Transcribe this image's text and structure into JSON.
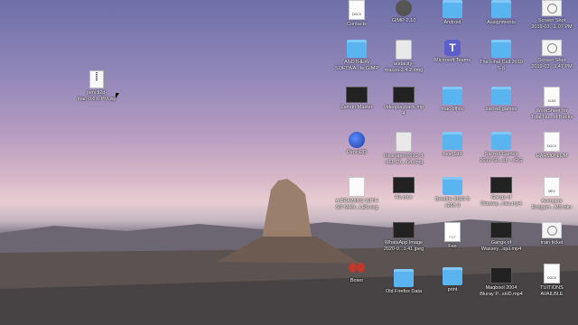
{
  "desktop": {
    "icons": [
      {
        "label": "Contacts",
        "type": "doc",
        "tag": "DOCX"
      },
      {
        "label": "GIMP-2.10",
        "type": "gimp"
      },
      {
        "label": "Android",
        "type": "folder"
      },
      {
        "label": "Assignments",
        "type": "folder"
      },
      {
        "label": "Screen Shot\n2019-03...1.07 PM",
        "type": "shot"
      },
      {
        "label": "ANDTHEW\nSOFTWA...te GIMP",
        "type": "folder"
      },
      {
        "label": "audacity-\nmacos-2.4.2.dmg",
        "type": "dmg"
      },
      {
        "label": "Microsoft Teams",
        "type": "teams"
      },
      {
        "label": "The Final Call 2019\nS 6",
        "type": "folder"
      },
      {
        "label": "Screen Shot\n2019-03...9.47 PM",
        "type": "shot"
      },
      {
        "label": "pencil2d-\nmac-0.6.6 PM.zip",
        "type": "zip"
      },
      {
        "label": "Lamdn Master",
        "type": "video"
      },
      {
        "label": "videoplayback.mp\n4",
        "type": "video"
      },
      {
        "label": "mac office",
        "type": "folder"
      },
      {
        "label": "sacred games",
        "type": "folder"
      },
      {
        "label": "WorkSheet for\nTotal Nu...of Books",
        "type": "doc",
        "tag": "XLSX"
      },
      {
        "label": "Pencil2D",
        "type": "pencil"
      },
      {
        "label": "Inkscape-0.92.2-1\n-x11-10....64.dmg",
        "type": "dmg"
      },
      {
        "label": "hesc1dd",
        "type": "folder"
      },
      {
        "label": "Sacred Games\n2019 S0...ub - xRG",
        "type": "folder"
      },
      {
        "label": "HARMONIUM",
        "type": "doc",
        "tag": "DOCX"
      },
      {
        "label": "A DRAWING WITH\nSO MAN...LES.svg",
        "type": "doc",
        "tag": ""
      },
      {
        "label": "Ho.mov",
        "type": "video"
      },
      {
        "label": "Breathe 2019 S\nx265 9",
        "type": "folder"
      },
      {
        "label": "Gangs of\nWassey...vies.mp4",
        "type": "video"
      },
      {
        "label": "Avengers\nEndgam...M8.mkv",
        "type": "doc",
        "tag": "MKV"
      },
      {
        "label": "WhatsApp Image\n2020-0...1.41.jpeg",
        "type": "video"
      },
      {
        "label": "Fee",
        "type": "pdf",
        "tag": "PDF"
      },
      {
        "label": "Gangs of\nWassey...iqui.mp4",
        "type": "video"
      },
      {
        "label": "train ticket",
        "type": "shot"
      },
      {
        "label": "Boxer",
        "type": "boxer"
      },
      {
        "label": "Old Firefox Data",
        "type": "folder"
      },
      {
        "label": "print",
        "type": "folder"
      },
      {
        "label": "Maqbool 2004\nBluray P...sHD.mp4",
        "type": "video"
      },
      {
        "label": "TUITIONS\nAVAILBLE",
        "type": "doc",
        "tag": "DOCX"
      }
    ]
  }
}
